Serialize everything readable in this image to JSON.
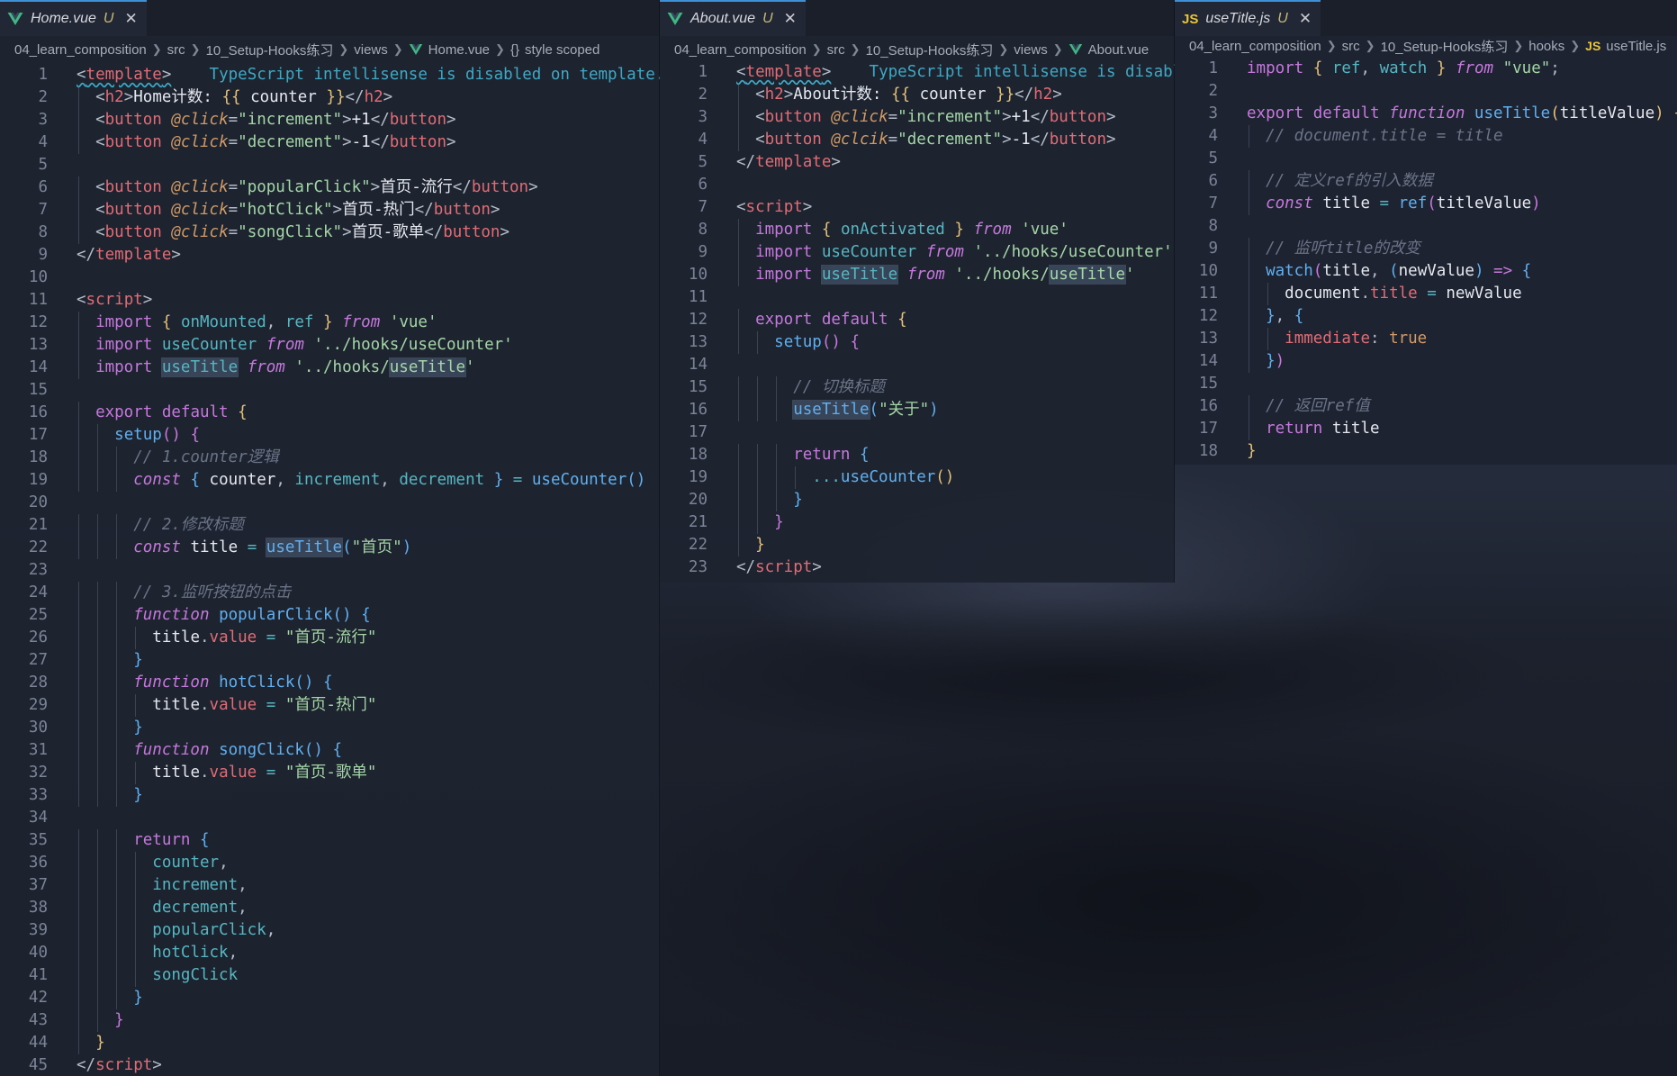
{
  "panes": {
    "home": {
      "tab": {
        "file": "Home.vue",
        "status": "U",
        "icon": "vue-icon"
      },
      "breadcrumb": [
        "04_learn_composition",
        "src",
        "10_Setup-Hooks练习",
        "views",
        "Home.vue",
        "style scoped"
      ],
      "lines": [
        {
          "n": "1",
          "html": "<span class='t-punc sq-under'>&lt;</span><span class='t-tag sq-under'>template</span><span class='t-punc sq-under'>&gt;</span>    <span class='t-warn'>TypeScript intellisense is disabled on template.</span>"
        },
        {
          "n": "2",
          "html": "  <span class='t-punc'>&lt;</span><span class='t-tag'>h2</span><span class='t-punc'>&gt;</span><span class='t-text'>Home计数: </span><span class='t-brace1'>{{</span> <span class='t-var'>counter</span> <span class='t-brace1'>}}</span><span class='t-punc'>&lt;/</span><span class='t-tag'>h2</span><span class='t-punc'>&gt;</span>"
        },
        {
          "n": "3",
          "html": "  <span class='t-punc'>&lt;</span><span class='t-tag'>button</span> <span class='t-attr'>@click</span><span class='t-punc'>=</span><span class='t-str'>\"increment\"</span><span class='t-punc'>&gt;</span><span class='t-text'>+1</span><span class='t-punc'>&lt;/</span><span class='t-tag'>button</span><span class='t-punc'>&gt;</span>"
        },
        {
          "n": "4",
          "html": "  <span class='t-punc'>&lt;</span><span class='t-tag'>button</span> <span class='t-attr'>@click</span><span class='t-punc'>=</span><span class='t-str'>\"decrement\"</span><span class='t-punc'>&gt;</span><span class='t-text'>-1</span><span class='t-punc'>&lt;/</span><span class='t-tag'>button</span><span class='t-punc'>&gt;</span>"
        },
        {
          "n": "5",
          "html": ""
        },
        {
          "n": "6",
          "html": "  <span class='t-punc'>&lt;</span><span class='t-tag'>button</span> <span class='t-attr'>@click</span><span class='t-punc'>=</span><span class='t-str'>\"popularClick\"</span><span class='t-punc'>&gt;</span><span class='t-text'>首页-流行</span><span class='t-punc'>&lt;/</span><span class='t-tag'>button</span><span class='t-punc'>&gt;</span>"
        },
        {
          "n": "7",
          "html": "  <span class='t-punc'>&lt;</span><span class='t-tag'>button</span> <span class='t-attr'>@click</span><span class='t-punc'>=</span><span class='t-str'>\"hotClick\"</span><span class='t-punc'>&gt;</span><span class='t-text'>首页-热门</span><span class='t-punc'>&lt;/</span><span class='t-tag'>button</span><span class='t-punc'>&gt;</span>"
        },
        {
          "n": "8",
          "html": "  <span class='t-punc'>&lt;</span><span class='t-tag'>button</span> <span class='t-attr'>@click</span><span class='t-punc'>=</span><span class='t-str'>\"songClick\"</span><span class='t-punc'>&gt;</span><span class='t-text'>首页-歌单</span><span class='t-punc'>&lt;/</span><span class='t-tag'>button</span><span class='t-punc'>&gt;</span>"
        },
        {
          "n": "9",
          "html": "<span class='t-punc'>&lt;/</span><span class='t-tag'>template</span><span class='t-punc'>&gt;</span>"
        },
        {
          "n": "10",
          "html": ""
        },
        {
          "n": "11",
          "html": "<span class='t-punc'>&lt;</span><span class='t-tag'>script</span><span class='t-punc'>&gt;</span>"
        },
        {
          "n": "12",
          "html": "  <span class='t-kw'>import</span> <span class='t-brace1'>{</span> <span class='t-ident'>onMounted</span><span class='t-punc'>,</span> <span class='t-ident'>ref</span> <span class='t-brace1'>}</span> <span class='t-kw-i'>from</span> <span class='t-str'>'vue'</span>"
        },
        {
          "n": "13",
          "html": "  <span class='t-kw'>import</span> <span class='t-ident'>useCounter</span> <span class='t-kw-i'>from</span> <span class='t-str'>'../hooks/useCounter'</span>"
        },
        {
          "n": "14",
          "html": "  <span class='t-kw'>import</span> <span class='t-ident hl-word'>useTitle</span> <span class='t-kw-i'>from</span> <span class='t-str'>'../hooks/<span class=\"hl-word\">useTitle</span>'</span>"
        },
        {
          "n": "15",
          "html": ""
        },
        {
          "n": "16",
          "html": "  <span class='t-kw'>export</span> <span class='t-kw'>default</span> <span class='t-brace1'>{</span>"
        },
        {
          "n": "17",
          "html": "    <span class='t-fn'>setup</span><span class='t-brace2'>()</span> <span class='t-brace2'>{</span>"
        },
        {
          "n": "18",
          "html": "      <span class='t-cmt'>// 1.counter逻辑</span>"
        },
        {
          "n": "19",
          "html": "      <span class='t-kw-i'>const</span> <span class='t-brace3'>{</span> <span class='t-var'>counter</span><span class='t-punc'>,</span> <span class='t-ident'>increment</span><span class='t-punc'>,</span> <span class='t-ident'>decrement</span> <span class='t-brace3'>}</span> <span class='t-op'>=</span> <span class='t-fn'>useCounter</span><span class='t-brace3'>()</span>"
        },
        {
          "n": "20",
          "html": ""
        },
        {
          "n": "21",
          "html": "      <span class='t-cmt'>// 2.修改标题</span>"
        },
        {
          "n": "22",
          "html": "      <span class='t-kw-i'>const</span> <span class='t-var'>title</span> <span class='t-op'>=</span> <span class='t-fn hl-word'>useTitle</span><span class='t-brace3'>(</span><span class='t-str'>\"首页\"</span><span class='t-brace3'>)</span>"
        },
        {
          "n": "23",
          "html": ""
        },
        {
          "n": "24",
          "html": "      <span class='t-cmt'>// 3.监听按钮的点击</span>"
        },
        {
          "n": "25",
          "html": "      <span class='t-kw-i'>function</span> <span class='t-fn'>popularClick</span><span class='t-brace3'>()</span> <span class='t-brace3'>{</span>"
        },
        {
          "n": "26",
          "html": "        <span class='t-var'>title</span><span class='t-punc'>.</span><span class='t-tag'>value</span> <span class='t-op'>=</span> <span class='t-str'>\"首页-流行\"</span>"
        },
        {
          "n": "27",
          "html": "      <span class='t-brace3'>}</span>"
        },
        {
          "n": "28",
          "html": "      <span class='t-kw-i'>function</span> <span class='t-fn'>hotClick</span><span class='t-brace3'>()</span> <span class='t-brace3'>{</span>"
        },
        {
          "n": "29",
          "html": "        <span class='t-var'>title</span><span class='t-punc'>.</span><span class='t-tag'>value</span> <span class='t-op'>=</span> <span class='t-str'>\"首页-热门\"</span>"
        },
        {
          "n": "30",
          "html": "      <span class='t-brace3'>}</span>"
        },
        {
          "n": "31",
          "html": "      <span class='t-kw-i'>function</span> <span class='t-fn'>songClick</span><span class='t-brace3'>()</span> <span class='t-brace3'>{</span>"
        },
        {
          "n": "32",
          "html": "        <span class='t-var'>title</span><span class='t-punc'>.</span><span class='t-tag'>value</span> <span class='t-op'>=</span> <span class='t-str'>\"首页-歌单\"</span>"
        },
        {
          "n": "33",
          "html": "      <span class='t-brace3'>}</span>"
        },
        {
          "n": "34",
          "html": ""
        },
        {
          "n": "35",
          "html": "      <span class='t-kw'>return</span> <span class='t-brace3'>{</span>"
        },
        {
          "n": "36",
          "html": "        <span class='t-ident'>counter</span><span class='t-punc'>,</span>"
        },
        {
          "n": "37",
          "html": "        <span class='t-ident'>increment</span><span class='t-punc'>,</span>"
        },
        {
          "n": "38",
          "html": "        <span class='t-ident'>decrement</span><span class='t-punc'>,</span>"
        },
        {
          "n": "39",
          "html": "        <span class='t-ident'>popularClick</span><span class='t-punc'>,</span>"
        },
        {
          "n": "40",
          "html": "        <span class='t-ident'>hotClick</span><span class='t-punc'>,</span>"
        },
        {
          "n": "41",
          "html": "        <span class='t-ident'>songClick</span>"
        },
        {
          "n": "42",
          "html": "      <span class='t-brace3'>}</span>"
        },
        {
          "n": "43",
          "html": "    <span class='t-brace2'>}</span>"
        },
        {
          "n": "44",
          "html": "  <span class='t-brace1'>}</span>"
        },
        {
          "n": "45",
          "html": "<span class='t-punc'>&lt;/</span><span class='t-tag'>script</span><span class='t-punc'>&gt;</span>"
        }
      ]
    },
    "about": {
      "tab": {
        "file": "About.vue",
        "status": "U",
        "icon": "vue-icon"
      },
      "breadcrumb": [
        "04_learn_composition",
        "src",
        "10_Setup-Hooks练习",
        "views",
        "About.vue"
      ],
      "lines": [
        {
          "n": "1",
          "html": "<span class='t-punc sq-under'>&lt;</span><span class='t-tag sq-under'>template</span><span class='t-punc sq-under'>&gt;</span>    <span class='t-warn'>TypeScript intellisense is disable</span>"
        },
        {
          "n": "2",
          "html": "  <span class='t-punc'>&lt;</span><span class='t-tag'>h2</span><span class='t-punc'>&gt;</span><span class='t-text'>About计数: </span><span class='t-brace1'>{{</span> <span class='t-var'>counter</span> <span class='t-brace1'>}}</span><span class='t-punc'>&lt;/</span><span class='t-tag'>h2</span><span class='t-punc'>&gt;</span>"
        },
        {
          "n": "3",
          "html": "  <span class='t-punc'>&lt;</span><span class='t-tag'>button</span> <span class='t-attr'>@click</span><span class='t-punc'>=</span><span class='t-str'>\"increment\"</span><span class='t-punc'>&gt;</span><span class='t-text'>+1</span><span class='t-punc'>&lt;/</span><span class='t-tag'>button</span><span class='t-punc'>&gt;</span>"
        },
        {
          "n": "4",
          "html": "  <span class='t-punc'>&lt;</span><span class='t-tag'>button</span> <span class='t-attr'>@clcik</span><span class='t-punc'>=</span><span class='t-str'>\"decrement\"</span><span class='t-punc'>&gt;</span><span class='t-text'>-1</span><span class='t-punc'>&lt;/</span><span class='t-tag'>button</span><span class='t-punc'>&gt;</span>"
        },
        {
          "n": "5",
          "html": "<span class='t-punc'>&lt;/</span><span class='t-tag'>template</span><span class='t-punc'>&gt;</span>"
        },
        {
          "n": "6",
          "html": ""
        },
        {
          "n": "7",
          "html": "<span class='t-punc'>&lt;</span><span class='t-tag'>script</span><span class='t-punc'>&gt;</span>"
        },
        {
          "n": "8",
          "html": "  <span class='t-kw'>import</span> <span class='t-brace1'>{</span> <span class='t-ident'>onActivated</span> <span class='t-brace1'>}</span> <span class='t-kw-i'>from</span> <span class='t-str'>'vue'</span>"
        },
        {
          "n": "9",
          "html": "  <span class='t-kw'>import</span> <span class='t-ident'>useCounter</span> <span class='t-kw-i'>from</span> <span class='t-str'>'../hooks/useCounter'</span>"
        },
        {
          "n": "10",
          "html": "  <span class='t-kw'>import</span> <span class='t-ident hl-word'>useTitle</span> <span class='t-kw-i'>from</span> <span class='t-str'>'../hooks/<span class=\"hl-word\">useTitle</span>'</span>"
        },
        {
          "n": "11",
          "html": ""
        },
        {
          "n": "12",
          "html": "  <span class='t-kw'>export</span> <span class='t-kw'>default</span> <span class='t-brace1'>{</span>"
        },
        {
          "n": "13",
          "html": "    <span class='t-fn'>setup</span><span class='t-brace2'>()</span> <span class='t-brace2'>{</span>"
        },
        {
          "n": "14",
          "html": ""
        },
        {
          "n": "15",
          "html": "      <span class='t-cmt'>// 切换标题</span>"
        },
        {
          "n": "16",
          "html": "      <span class='t-fn hl-word'>useTitle</span><span class='t-brace3'>(</span><span class='t-str'>\"关于\"</span><span class='t-brace3'>)</span>"
        },
        {
          "n": "17",
          "html": ""
        },
        {
          "n": "18",
          "html": "      <span class='t-kw'>return</span> <span class='t-brace3'>{</span>"
        },
        {
          "n": "19",
          "html": "        <span class='t-op'>...</span><span class='t-fn'>useCounter</span><span class='t-brace1'>()</span>"
        },
        {
          "n": "20",
          "html": "      <span class='t-brace3'>}</span>"
        },
        {
          "n": "21",
          "html": "    <span class='t-brace2'>}</span>"
        },
        {
          "n": "22",
          "html": "  <span class='t-brace1'>}</span>"
        },
        {
          "n": "23",
          "html": "<span class='t-punc'>&lt;/</span><span class='t-tag'>script</span><span class='t-punc'>&gt;</span>"
        }
      ]
    },
    "usetitle": {
      "tab": {
        "file": "useTitle.js",
        "status": "U",
        "icon": "js-icon"
      },
      "breadcrumb": [
        "04_learn_composition",
        "src",
        "10_Setup-Hooks练习",
        "hooks",
        "useTitle.js"
      ],
      "lines": [
        {
          "n": "1",
          "html": "<span class='t-kw'>import</span> <span class='t-brace1'>{</span> <span class='t-ident'>ref</span><span class='t-punc'>,</span> <span class='t-ident'>watch</span> <span class='t-brace1'>}</span> <span class='t-kw-i'>from</span> <span class='t-str'>\"vue\"</span><span class='t-punc'>;</span>"
        },
        {
          "n": "2",
          "html": ""
        },
        {
          "n": "3",
          "html": "<span class='t-kw'>export</span> <span class='t-kw'>default</span> <span class='t-kw-i'>function</span> <span class='t-fn'>useTitle</span><span class='t-brace1'>(</span><span class='t-var'>titleValue</span><span class='t-brace1'>)</span> <span class='t-brace1'>{</span>"
        },
        {
          "n": "4",
          "html": "  <span class='t-cmt'>// document.title = title</span>"
        },
        {
          "n": "5",
          "html": ""
        },
        {
          "n": "6",
          "html": "  <span class='t-cmt'>// 定义ref的引入数据</span>"
        },
        {
          "n": "7",
          "html": "  <span class='t-kw-i'>const</span> <span class='t-var'>title</span> <span class='t-op'>=</span> <span class='t-fn'>ref</span><span class='t-brace2'>(</span><span class='t-var'>titleValue</span><span class='t-brace2'>)</span>"
        },
        {
          "n": "8",
          "html": ""
        },
        {
          "n": "9",
          "html": "  <span class='t-cmt'>// 监听title的改变</span>"
        },
        {
          "n": "10",
          "html": "  <span class='t-fn'>watch</span><span class='t-brace2'>(</span><span class='t-var'>title</span><span class='t-punc'>,</span> <span class='t-brace3'>(</span><span class='t-var'>newValue</span><span class='t-brace3'>)</span> <span class='t-kw'>=&gt;</span> <span class='t-brace3'>{</span>"
        },
        {
          "n": "11",
          "html": "    <span class='t-var'>document</span><span class='t-punc'>.</span><span class='t-tag'>title</span> <span class='t-op'>=</span> <span class='t-var'>newValue</span>"
        },
        {
          "n": "12",
          "html": "  <span class='t-brace3'>}</span><span class='t-punc'>,</span> <span class='t-brace3'>{</span>"
        },
        {
          "n": "13",
          "html": "    <span class='t-tag'>immediate</span><span class='t-punc'>:</span> <span class='t-bool'>true</span>"
        },
        {
          "n": "14",
          "html": "  <span class='t-brace3'>}</span><span class='t-brace2'>)</span>"
        },
        {
          "n": "15",
          "html": ""
        },
        {
          "n": "16",
          "html": "  <span class='t-cmt'>// 返回ref值</span>"
        },
        {
          "n": "17",
          "html": "  <span class='t-kw'>return</span> <span class='t-var'>title</span>"
        },
        {
          "n": "18",
          "html": "<span class='t-brace1'>}</span>"
        }
      ]
    }
  }
}
